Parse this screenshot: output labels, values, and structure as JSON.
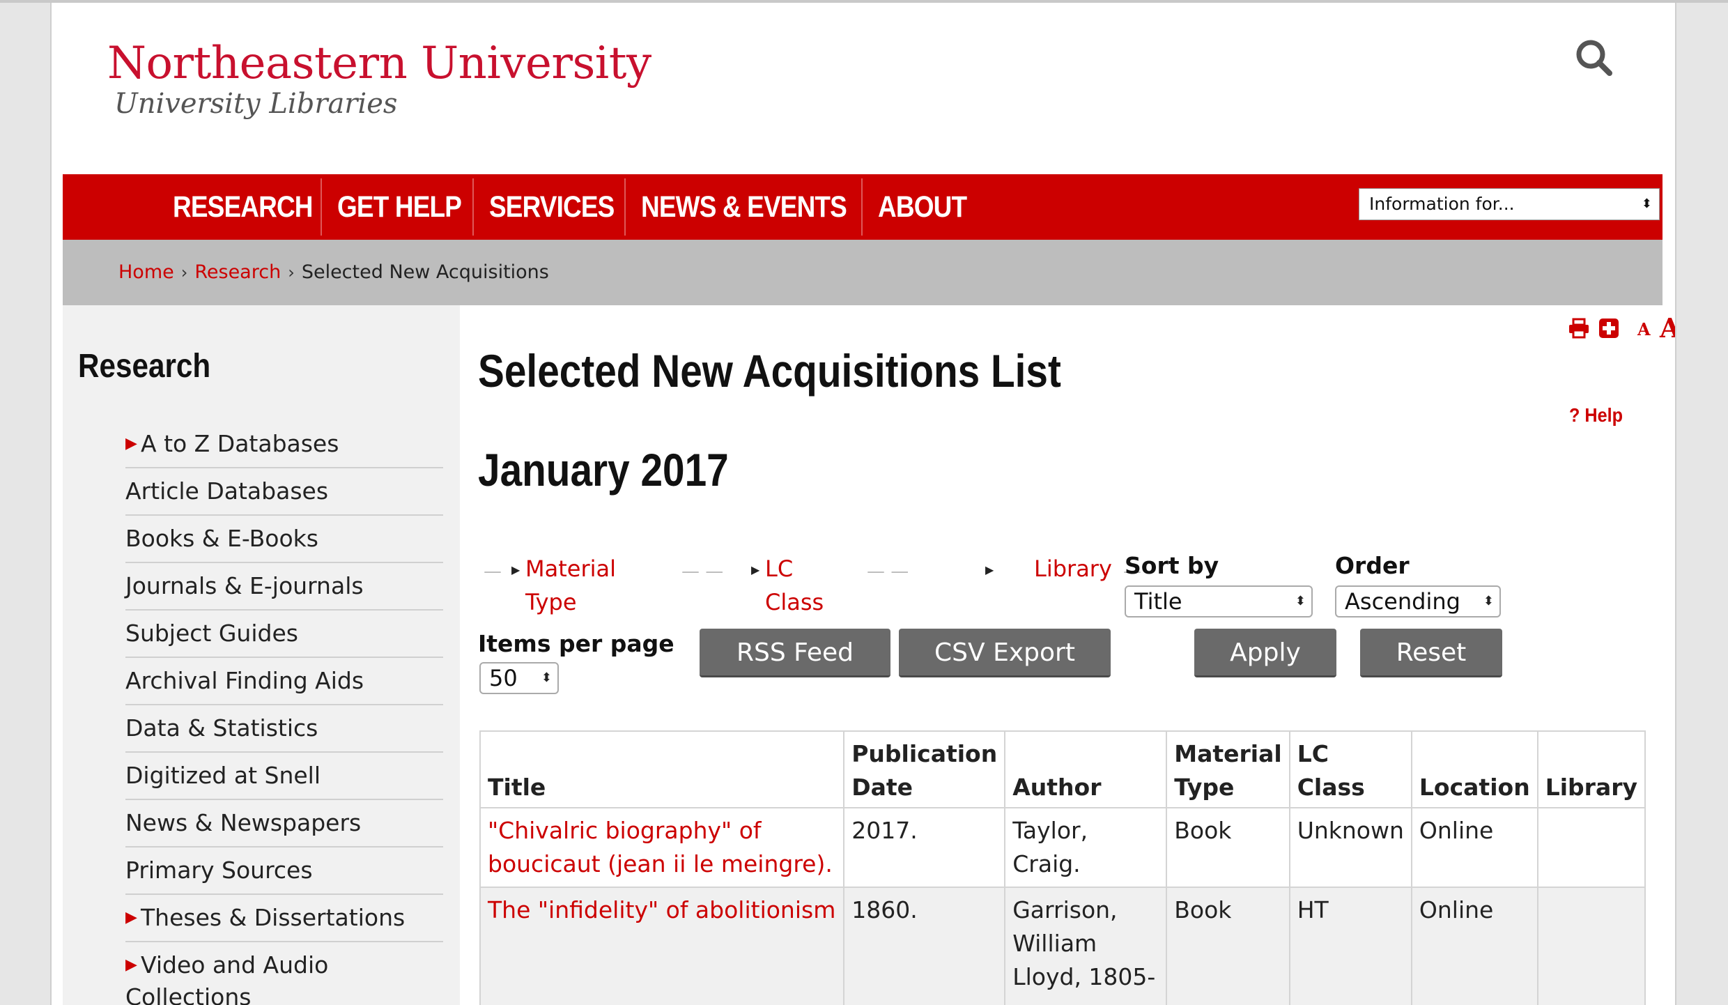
{
  "header": {
    "logo_main": "Northeastern University",
    "logo_sub": "University Libraries",
    "search_icon": "magnifier"
  },
  "nav": {
    "items": [
      "RESEARCH",
      "GET HELP",
      "SERVICES",
      "NEWS & EVENTS",
      "ABOUT"
    ],
    "info_select": "Information for..."
  },
  "breadcrumb": {
    "home": "Home",
    "research": "Research",
    "current": "Selected New Acquisitions"
  },
  "sidebar": {
    "title": "Research",
    "items": [
      {
        "label": "A to Z Databases",
        "expandable": true
      },
      {
        "label": "Article Databases",
        "expandable": false
      },
      {
        "label": "Books & E-Books",
        "expandable": false
      },
      {
        "label": "Journals & E-journals",
        "expandable": false
      },
      {
        "label": "Subject Guides",
        "expandable": false
      },
      {
        "label": "Archival Finding Aids",
        "expandable": false
      },
      {
        "label": "Data & Statistics",
        "expandable": false
      },
      {
        "label": "Digitized at Snell",
        "expandable": false
      },
      {
        "label": "News & Newspapers",
        "expandable": false
      },
      {
        "label": "Primary Sources",
        "expandable": false
      },
      {
        "label": "Theses & Dissertations",
        "expandable": true
      },
      {
        "label": "Video and Audio Collections",
        "expandable": true
      }
    ]
  },
  "tools": {
    "print_icon": "printer",
    "share_icon": "plus-square",
    "font_small": "A",
    "font_large": "A"
  },
  "main": {
    "title": "Selected New Acquisitions List",
    "help": "? Help",
    "month": "January 2017"
  },
  "filters": {
    "material_type_1": "Material",
    "material_type_2": "Type",
    "lc_class_1": "LC",
    "lc_class_2": "Class",
    "library": "Library",
    "sort_by_label": "Sort by",
    "sort_by_value": "Title",
    "order_label": "Order",
    "order_value": "Ascending",
    "items_per_page_label": "Items per page",
    "items_per_page_value": "50"
  },
  "buttons": {
    "rss": "RSS Feed",
    "csv": "CSV Export",
    "apply": "Apply",
    "reset": "Reset"
  },
  "table": {
    "headers": {
      "title": "Title",
      "pub_date_1": "Publication",
      "pub_date_2": "Date",
      "author": "Author",
      "material_type_1": "Material",
      "material_type_2": "Type",
      "lc_class": "LC Class",
      "location": "Location",
      "library": "Library"
    },
    "rows": [
      {
        "title_1": "\"Chivalric biography\" of",
        "title_2": "boucicaut (jean ii le meingre).",
        "pub_date": "2017.",
        "author_1": "Taylor,",
        "author_2": "Craig.",
        "author_3": "",
        "material_type": "Book",
        "lc_class": "Unknown",
        "location": "Online",
        "library": ""
      },
      {
        "title_1": "The \"infidelity\" of abolitionism",
        "title_2": "",
        "pub_date": "1860.",
        "author_1": "Garrison,",
        "author_2": "William",
        "author_3": "Lloyd, 1805-",
        "material_type": "Book",
        "lc_class": "HT",
        "location": "Online",
        "library": ""
      }
    ]
  },
  "colors": {
    "brand_red": "#cc0000",
    "link_red": "#c00000",
    "breadcrumb_bg": "#bdbdbd",
    "sidebar_bg": "#f1f1f1",
    "button_gray": "#6a6a6a"
  }
}
